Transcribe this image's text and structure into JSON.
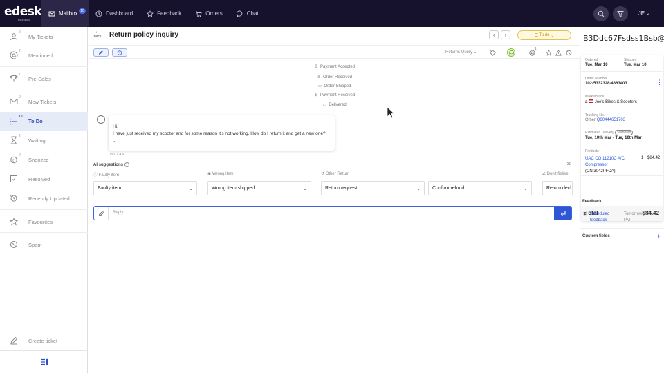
{
  "topbar": {
    "logo": "edesk",
    "logo_sub": "by xSellco",
    "nav": [
      {
        "label": "Mailbox",
        "badge": "10",
        "icon": "mail-icon"
      },
      {
        "label": "Dashboard",
        "icon": "clock-icon"
      },
      {
        "label": "Feedback",
        "icon": "star-icon"
      },
      {
        "label": "Orders",
        "icon": "cart-icon"
      },
      {
        "label": "Chat",
        "icon": "chat-icon"
      }
    ],
    "user_initials": "JE"
  },
  "sidebar": {
    "items": [
      {
        "label": "My Tickets",
        "count": "2",
        "icon": "user-icon"
      },
      {
        "label": "Mentioned",
        "count": "2",
        "icon": "at-icon"
      },
      {
        "label": "Pre-Sales",
        "count": "1",
        "icon": "trophy-icon"
      },
      {
        "label": "New Tickets",
        "count": "9",
        "icon": "inbox-icon"
      },
      {
        "label": "To Do",
        "count": "10",
        "icon": "list-icon"
      },
      {
        "label": "Waiting",
        "count": "2",
        "icon": "hourglass-icon"
      },
      {
        "label": "Snoozed",
        "count": "2",
        "icon": "snooze-icon"
      },
      {
        "label": "Resolved",
        "count": "",
        "icon": "check-icon"
      },
      {
        "label": "Recently Updated",
        "count": "",
        "icon": "history-icon"
      },
      {
        "label": "Favourites",
        "count": "",
        "icon": "star-icon"
      },
      {
        "label": "Spam",
        "count": "",
        "icon": "ban-icon"
      }
    ],
    "create_ticket": "Create ticket"
  },
  "ticket": {
    "back_label": "Back",
    "subject": "Return policy inquiry",
    "status": "To do",
    "query_type": "Returns Query",
    "mention_count": "1"
  },
  "timeline": [
    {
      "label": "Payment Accepted",
      "icon": "dollar-icon"
    },
    {
      "label": "Order Received",
      "icon": "cart-icon"
    },
    {
      "label": "Order Shipped",
      "icon": "truck-icon"
    },
    {
      "label": "Payment Received",
      "icon": "dollar-icon"
    },
    {
      "label": "Delivered",
      "icon": "truck-icon"
    }
  ],
  "message": {
    "greeting": "Hi,",
    "body": "I have just received my scooter and for some reason it's not working. How do I return it and get a new one?",
    "ellipsis": "...",
    "time": "03:07 AM"
  },
  "ai": {
    "title": "AI suggestions",
    "columns": [
      {
        "label": "Faulty item",
        "icon": "info-icon"
      },
      {
        "label": "Wrong item",
        "icon": "eye-icon"
      },
      {
        "label": "Other Return",
        "icon": "return-icon"
      },
      {
        "label": "Don't fit/like",
        "icon": "swap-icon"
      }
    ],
    "dropdowns": [
      "Faulty item",
      "Wrong item shipped",
      "Return request",
      "Confirm refund",
      "Return decl"
    ]
  },
  "reply": {
    "placeholder": "Reply..."
  },
  "customer": {
    "title": "B3Ddc67Fsdss1Bsb@...",
    "ordered_label": "Ordered",
    "ordered": "Tue, Mar 10",
    "shipped_label": "Shipped",
    "shipped": "Tue, Mar 10",
    "order_number_label": "Order Number",
    "order_number": "102-5332328-4363403",
    "marketplace_label": "Marketplace",
    "marketplace": "Joe's Bikes & Scooters",
    "tracking_label": "Tracking No.",
    "tracking_carrier": "Other",
    "tracking": "Q60444651703",
    "delivery_label": "Estimated Delivery",
    "delivery_badge": "Standard",
    "delivery": "Tue, 10th Mar - Tue, 10th Mar",
    "products_label": "Products",
    "product_name": "UAC CO 11210C A/C Compressor",
    "product_code": "(CN 3042PFCA)",
    "product_qty": "1",
    "product_price": "$84.42",
    "total_label": "Total",
    "total": "$84.42",
    "feedback_label": "Feedback",
    "feedback_item": "Scheduled feedback",
    "feedback_time": "Tomorrow at 03:07 PM",
    "custom_fields_label": "Custom fields"
  },
  "colors": {
    "topbar": "#16122e",
    "accent": "#3056d8",
    "status": "#e0c455"
  }
}
